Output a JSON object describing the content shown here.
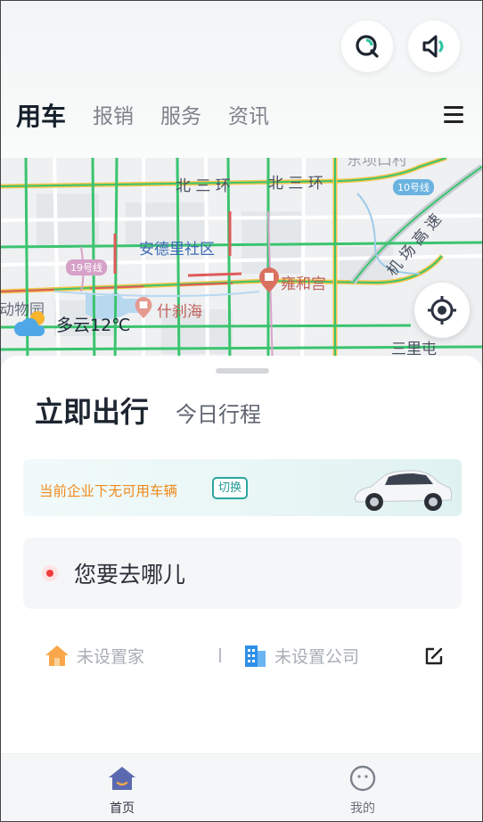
{
  "header": {
    "tabs": [
      {
        "label": "用车",
        "active": true
      },
      {
        "label": "报销",
        "active": false
      },
      {
        "label": "服务",
        "active": false
      },
      {
        "label": "资讯",
        "active": false
      }
    ],
    "icons": {
      "service": "customer-service-icon",
      "sound": "speaker-icon",
      "menu": "menu-icon"
    }
  },
  "map": {
    "labels": {
      "north_ring": "北 三 环",
      "north_ring_2": "北 三 环",
      "area": "安德里社区",
      "poi_temple": "雍和宫",
      "poi_lake": "什刹海",
      "zoo": "动物园",
      "sanlitun": "三里屯",
      "expressway": "机 场 高 速",
      "top_cut": "东坝口村"
    },
    "metro": {
      "line10": "10号线",
      "line19": "19号线"
    },
    "weather": {
      "condition": "多云",
      "temperature": "12℃",
      "text": "多云12℃"
    }
  },
  "sheet": {
    "tabs": [
      {
        "label": "立即出行",
        "active": true
      },
      {
        "label": "今日行程",
        "active": false
      }
    ],
    "banner": {
      "message": "当前企业下无可用车辆",
      "switch_label": "切换"
    },
    "destination_placeholder": "您要去哪儿",
    "home_label": "未设置家",
    "company_label": "未设置公司"
  },
  "bottom_nav": [
    {
      "label": "首页",
      "active": true
    },
    {
      "label": "我的",
      "active": false
    }
  ],
  "colors": {
    "accent": "#2aa5a0",
    "warning": "#f08a1c",
    "nav_active": "#5b6ab0",
    "dest_dot": "#ee3b3b",
    "traffic_green": "#3ac46f",
    "ring_road": "#f5c54a"
  }
}
